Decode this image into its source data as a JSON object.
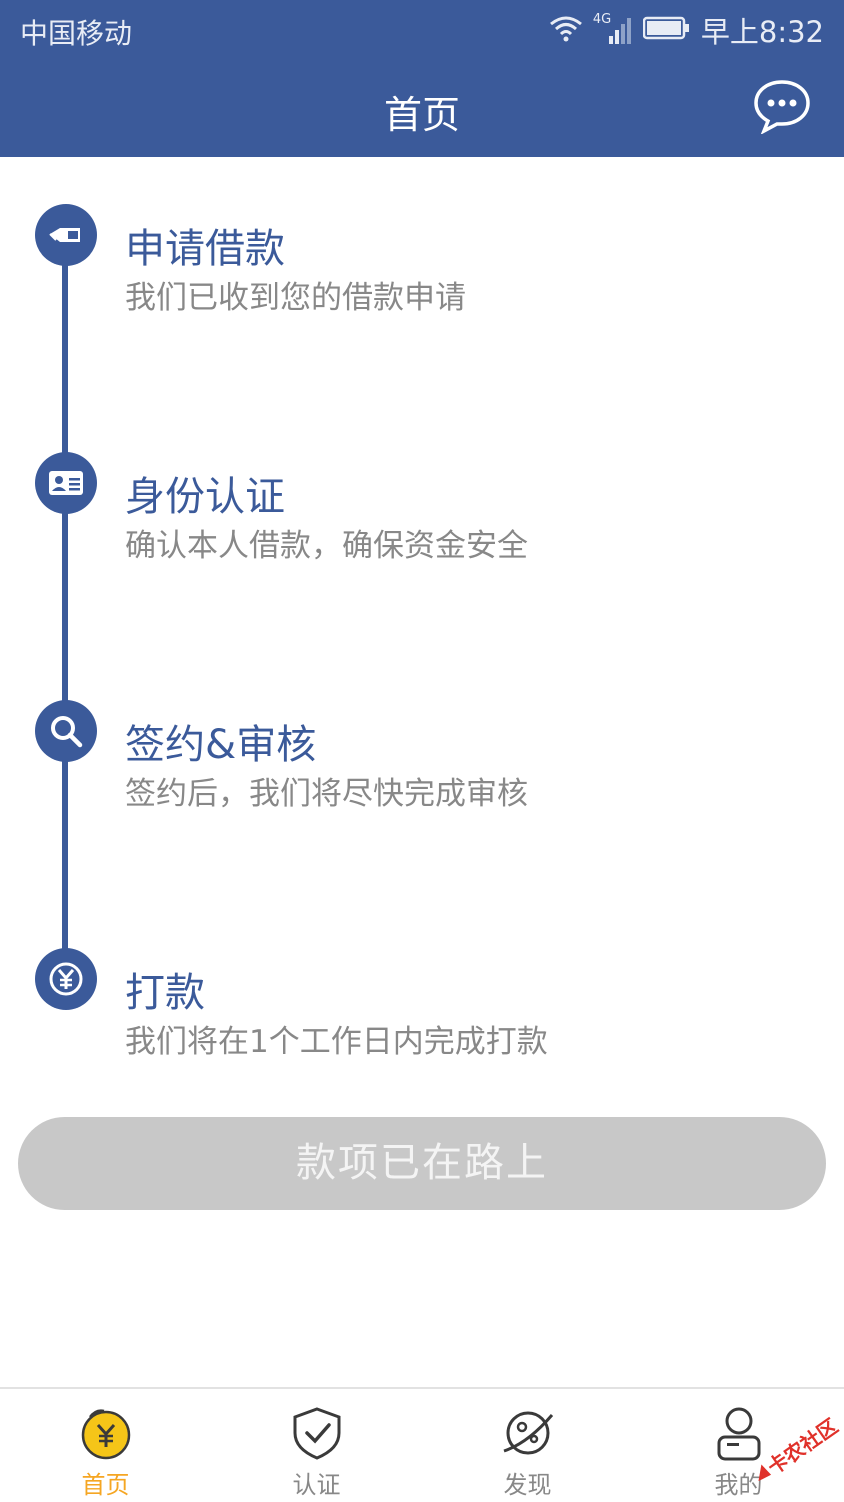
{
  "status_bar": {
    "carrier": "中国移动",
    "network": "4G",
    "time": "早上8:32"
  },
  "header": {
    "title": "首页",
    "message_icon": "chat-bubble-icon"
  },
  "steps": [
    {
      "icon": "hand-money-icon",
      "title": "申请借款",
      "desc": "我们已收到您的借款申请"
    },
    {
      "icon": "id-card-icon",
      "title": "身份认证",
      "desc": "确认本人借款，确保资金安全"
    },
    {
      "icon": "search-icon",
      "title": "签约&审核",
      "desc": "签约后，我们将尽快完成审核"
    },
    {
      "icon": "yuan-icon",
      "title": "打款",
      "desc": "我们将在1个工作日内完成打款"
    }
  ],
  "main_button": {
    "label": "款项已在路上",
    "state": "disabled"
  },
  "tabbar": {
    "items": [
      {
        "label": "首页",
        "icon": "yuan-coin-icon",
        "active": true
      },
      {
        "label": "认证",
        "icon": "shield-check-icon",
        "active": false
      },
      {
        "label": "发现",
        "icon": "planet-icon",
        "active": false
      },
      {
        "label": "我的",
        "icon": "user-icon",
        "active": false
      }
    ]
  },
  "watermark": {
    "text": "卡农社区"
  },
  "colors": {
    "brand": "#3b5a9a",
    "active_tab": "#f5a623",
    "button_disabled": "#c8c8c8",
    "desc_text": "#888888"
  }
}
